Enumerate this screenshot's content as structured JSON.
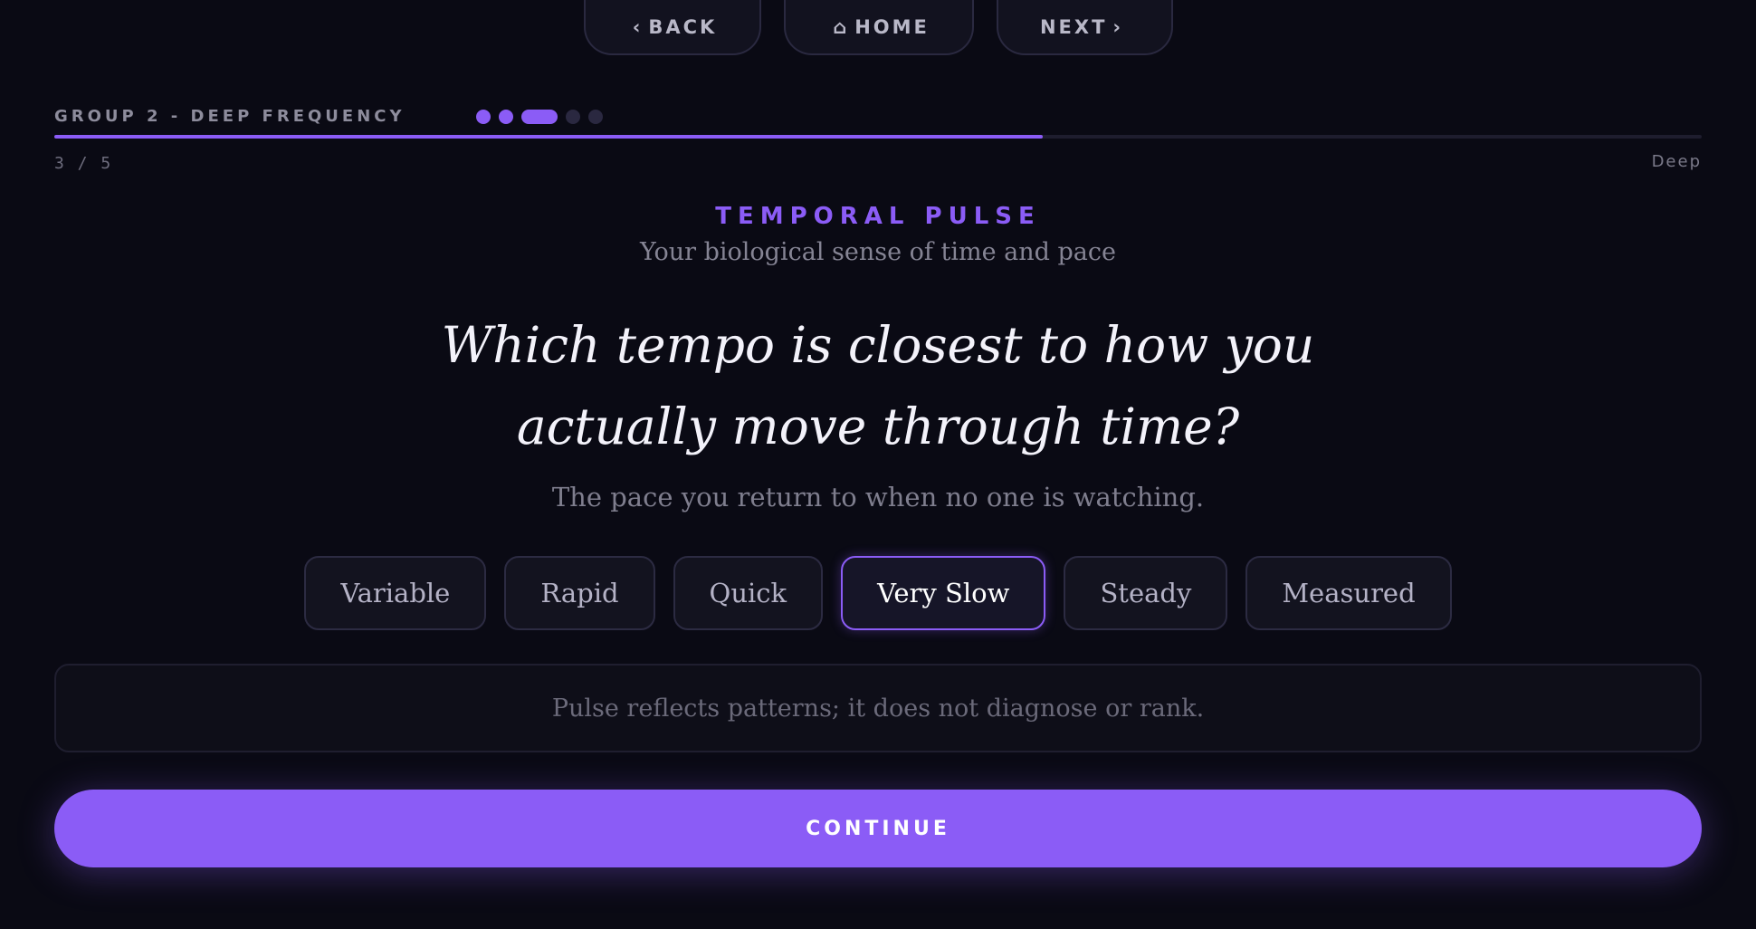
{
  "nav": {
    "back_glyph": "‹",
    "back_label": "BACK",
    "home_glyph": "⌂",
    "home_label": "HOME",
    "next_label": "NEXT",
    "next_glyph": "›"
  },
  "progress": {
    "group_label": "GROUP 2 - DEEP FREQUENCY",
    "current_step": 3,
    "total_steps": 5,
    "step_text": "3 / 5",
    "fraction": 0.6,
    "depth_label": "Deep",
    "accent_color": "#8b5cf6"
  },
  "section": {
    "title": "TEMPORAL PULSE",
    "subtitle": "Your biological sense of time and pace"
  },
  "question": {
    "text": "Which tempo is closest to how you actually move through time?",
    "hint": "The pace you return to when no one is watching."
  },
  "options": {
    "items": [
      {
        "label": "Variable",
        "selected": false
      },
      {
        "label": "Rapid",
        "selected": false
      },
      {
        "label": "Quick",
        "selected": false
      },
      {
        "label": "Very Slow",
        "selected": true
      },
      {
        "label": "Steady",
        "selected": false
      },
      {
        "label": "Measured",
        "selected": false
      }
    ]
  },
  "note": {
    "text": "Pulse reflects patterns; it does not diagnose or rank."
  },
  "actions": {
    "continue_label": "CONTINUE"
  }
}
